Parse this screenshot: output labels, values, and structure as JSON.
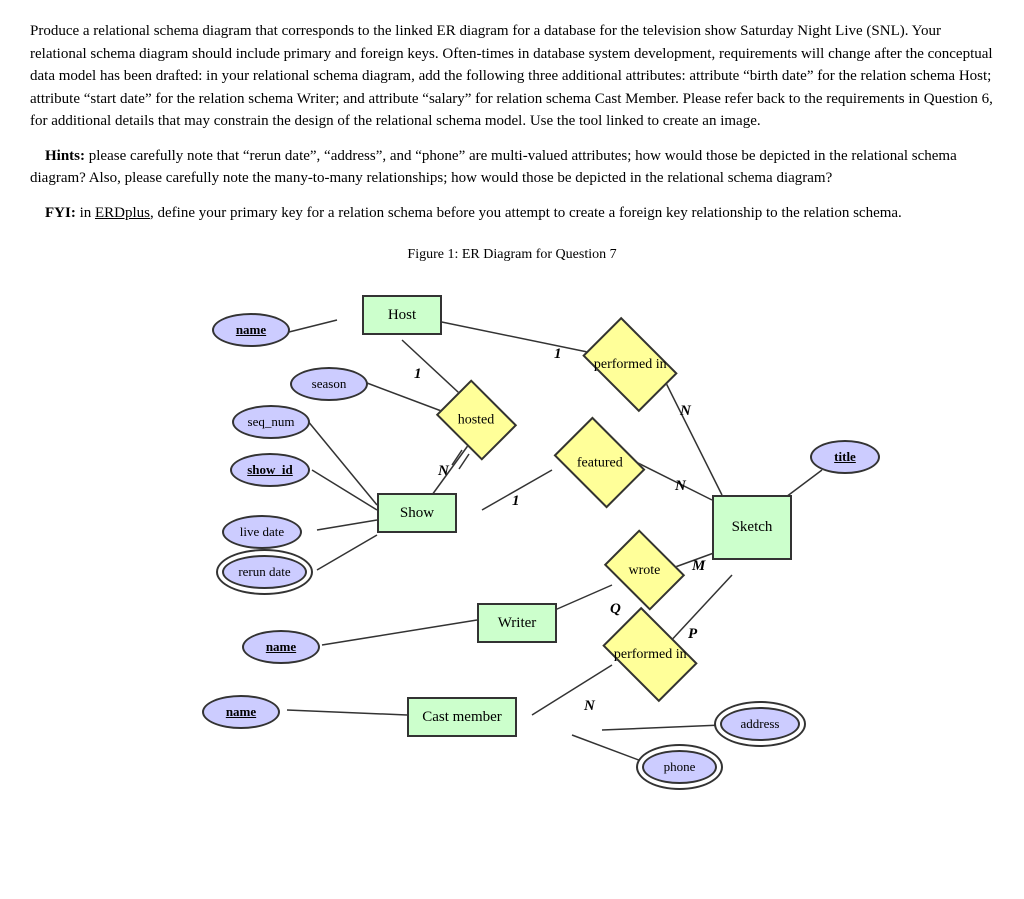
{
  "page": {
    "main_text": "Produce a relational schema diagram that corresponds to the linked ER diagram for a database for the television show Saturday Night Live (SNL). Your relational schema diagram should include primary and foreign keys. Often-times in database system development, requirements will change after the conceptual data model has been drafted: in your relational schema diagram, add the following three additional attributes: attribute “birth date” for the relation schema Host; attribute “start date” for the relation schema Writer; and attribute “salary” for relation schema Cast Member. Please refer back to the requirements in Question 6, for additional details that may constrain the design of the relational schema model. Use the tool linked to create an image.",
    "hints_label": "Hints:",
    "hints_text": " please carefully note that “rerun date”, “address”, and “phone” are multi-valued attributes; how would those be depicted in the relational schema diagram? Also, please carefully note the many-to-many relationships; how would those be depicted in the relational schema diagram?",
    "fyi_label": "FYI:",
    "fyi_text_pre": " in ",
    "fyi_link": "ERDplus",
    "fyi_text_post": ", define your primary key for a relation schema before you attempt to create a foreign key relationship to the relation schema.",
    "figure_caption": "Figure 1: ER Diagram for Question 7",
    "entities": {
      "host": "Host",
      "show": "Show",
      "writer": "Writer",
      "cast_member": "Cast member",
      "sketch": "Sketch"
    },
    "relationships": {
      "hosted": "hosted",
      "featured": "featured",
      "wrote": "wrote",
      "performed_in_top": "performed in",
      "performed_in_bottom": "performed in"
    },
    "attributes": {
      "host_name": "name",
      "show_season": "season",
      "show_seq_num": "seq_num",
      "show_show_id": "show_id",
      "show_live_date": "live date",
      "show_rerun_date": "rerun date",
      "sketch_title": "title",
      "writer_name": "name",
      "cast_name": "name",
      "cast_address": "address",
      "cast_phone": "phone"
    },
    "cardinalities": {
      "host_hosted_1": "1",
      "hosted_show_n": "N",
      "host_performedin_1": "1",
      "performedin_sketch_n": "N",
      "featured_show_1": "1",
      "featured_sketch_n": "N",
      "sketch_wrote_m": "M",
      "writer_wrote_q": "Q",
      "cast_performedin_n": "N",
      "performedin_sketch_p": "P"
    }
  }
}
